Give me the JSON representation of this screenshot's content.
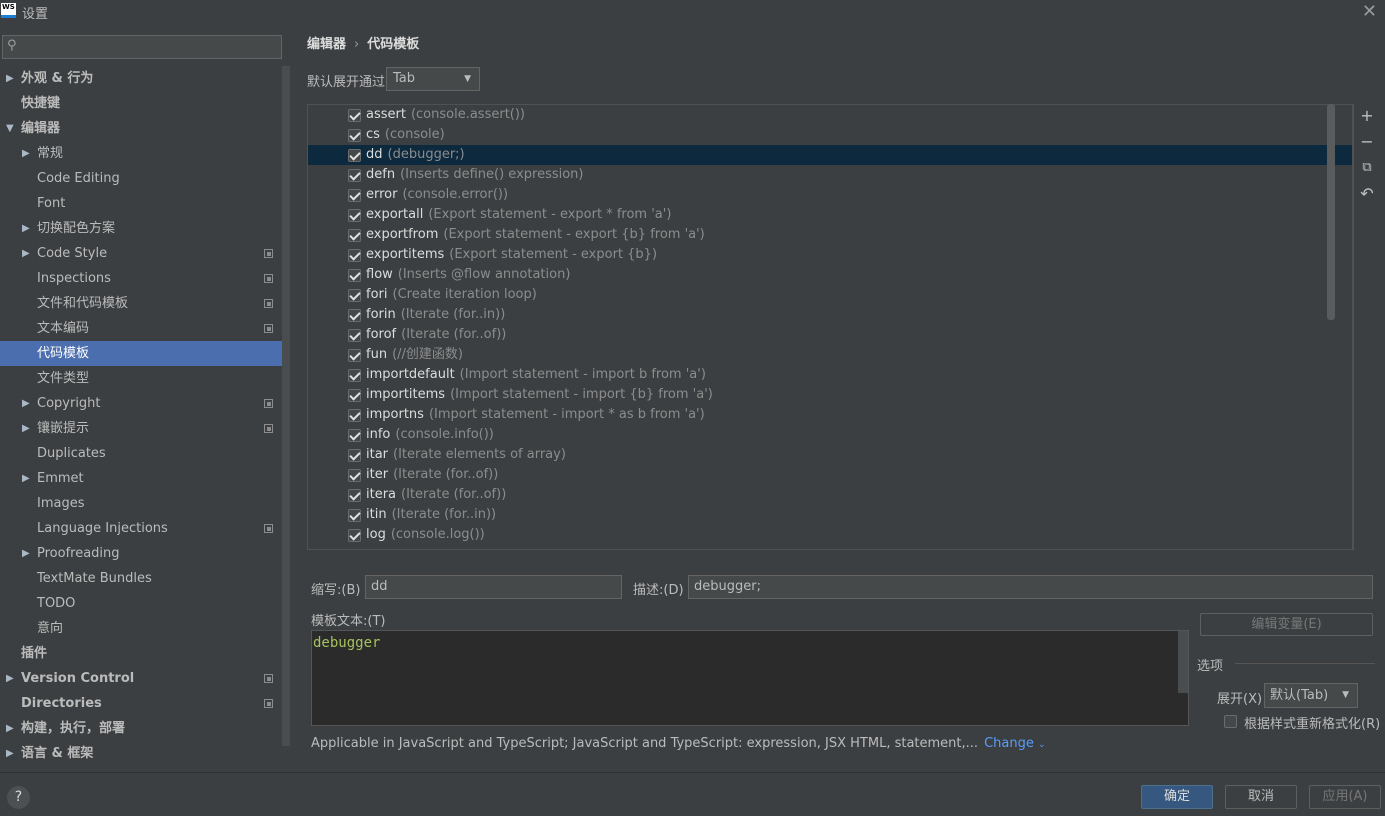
{
  "window": {
    "title": "设置",
    "logo": "WS"
  },
  "search": {
    "value": ""
  },
  "tree": [
    {
      "label": "外观 & 行为",
      "level": 0,
      "arrow": "right",
      "bold": true,
      "copy": false
    },
    {
      "label": "快捷键",
      "level": 0,
      "arrow": "",
      "bold": true,
      "copy": false
    },
    {
      "label": "编辑器",
      "level": 0,
      "arrow": "down",
      "bold": true,
      "copy": false
    },
    {
      "label": "常规",
      "level": 1,
      "arrow": "right",
      "bold": false,
      "copy": false
    },
    {
      "label": "Code Editing",
      "level": 1,
      "arrow": "",
      "bold": false,
      "copy": false
    },
    {
      "label": "Font",
      "level": 1,
      "arrow": "",
      "bold": false,
      "copy": false
    },
    {
      "label": "切换配色方案",
      "level": 1,
      "arrow": "right",
      "bold": false,
      "copy": false
    },
    {
      "label": "Code Style",
      "level": 1,
      "arrow": "right",
      "bold": false,
      "copy": true
    },
    {
      "label": "Inspections",
      "level": 1,
      "arrow": "",
      "bold": false,
      "copy": true
    },
    {
      "label": "文件和代码模板",
      "level": 1,
      "arrow": "",
      "bold": false,
      "copy": true
    },
    {
      "label": "文本编码",
      "level": 1,
      "arrow": "",
      "bold": false,
      "copy": true
    },
    {
      "label": "代码模板",
      "level": 1,
      "arrow": "",
      "bold": false,
      "copy": false,
      "selected": true
    },
    {
      "label": "文件类型",
      "level": 1,
      "arrow": "",
      "bold": false,
      "copy": false
    },
    {
      "label": "Copyright",
      "level": 1,
      "arrow": "right",
      "bold": false,
      "copy": true
    },
    {
      "label": "镶嵌提示",
      "level": 1,
      "arrow": "right",
      "bold": false,
      "copy": true
    },
    {
      "label": "Duplicates",
      "level": 1,
      "arrow": "",
      "bold": false,
      "copy": false
    },
    {
      "label": "Emmet",
      "level": 1,
      "arrow": "right",
      "bold": false,
      "copy": false
    },
    {
      "label": "Images",
      "level": 1,
      "arrow": "",
      "bold": false,
      "copy": false
    },
    {
      "label": "Language Injections",
      "level": 1,
      "arrow": "",
      "bold": false,
      "copy": true
    },
    {
      "label": "Proofreading",
      "level": 1,
      "arrow": "right",
      "bold": false,
      "copy": false
    },
    {
      "label": "TextMate Bundles",
      "level": 1,
      "arrow": "",
      "bold": false,
      "copy": false
    },
    {
      "label": "TODO",
      "level": 1,
      "arrow": "",
      "bold": false,
      "copy": false
    },
    {
      "label": "意向",
      "level": 1,
      "arrow": "",
      "bold": false,
      "copy": false
    },
    {
      "label": "插件",
      "level": 0,
      "arrow": "",
      "bold": true,
      "copy": false
    },
    {
      "label": "Version Control",
      "level": 0,
      "arrow": "right",
      "bold": true,
      "copy": true
    },
    {
      "label": "Directories",
      "level": 0,
      "arrow": "",
      "bold": true,
      "copy": true
    },
    {
      "label": "构建，执行，部署",
      "level": 0,
      "arrow": "right",
      "bold": true,
      "copy": false
    },
    {
      "label": "语言 & 框架",
      "level": 0,
      "arrow": "right",
      "bold": true,
      "copy": false
    }
  ],
  "breadcrumb": {
    "parent": "编辑器",
    "separator": "›",
    "current": "代码模板"
  },
  "expand": {
    "label": "默认展开通过",
    "value": "Tab"
  },
  "templates": [
    {
      "abbr": "assert",
      "desc": "(console.assert())",
      "checked": true
    },
    {
      "abbr": "cs",
      "desc": "(console)",
      "checked": true
    },
    {
      "abbr": "dd",
      "desc": "(debugger;)",
      "checked": true,
      "selected": true
    },
    {
      "abbr": "defn",
      "desc": "(Inserts define() expression)",
      "checked": true
    },
    {
      "abbr": "error",
      "desc": "(console.error())",
      "checked": true
    },
    {
      "abbr": "exportall",
      "desc": "(Export statement - export * from 'a')",
      "checked": true
    },
    {
      "abbr": "exportfrom",
      "desc": "(Export statement - export {b} from 'a')",
      "checked": true
    },
    {
      "abbr": "exportitems",
      "desc": "(Export statement - export {b})",
      "checked": true
    },
    {
      "abbr": "flow",
      "desc": "(Inserts @flow annotation)",
      "checked": true
    },
    {
      "abbr": "fori",
      "desc": "(Create iteration loop)",
      "checked": true
    },
    {
      "abbr": "forin",
      "desc": "(Iterate (for..in))",
      "checked": true
    },
    {
      "abbr": "forof",
      "desc": "(Iterate (for..of))",
      "checked": true
    },
    {
      "abbr": "fun",
      "desc": "(//创建函数)",
      "checked": true
    },
    {
      "abbr": "importdefault",
      "desc": "(Import statement - import b from 'a')",
      "checked": true
    },
    {
      "abbr": "importitems",
      "desc": "(Import statement - import {b} from 'a')",
      "checked": true
    },
    {
      "abbr": "importns",
      "desc": "(Import statement - import * as b from 'a')",
      "checked": true
    },
    {
      "abbr": "info",
      "desc": "(console.info())",
      "checked": true
    },
    {
      "abbr": "itar",
      "desc": "(Iterate elements of array)",
      "checked": true
    },
    {
      "abbr": "iter",
      "desc": "(Iterate (for..of))",
      "checked": true
    },
    {
      "abbr": "itera",
      "desc": "(Iterate (for..of))",
      "checked": true
    },
    {
      "abbr": "itin",
      "desc": "(Iterate (for..in))",
      "checked": true
    },
    {
      "abbr": "log",
      "desc": "(console.log())",
      "checked": true
    }
  ],
  "tools": {
    "add": "+",
    "remove": "−",
    "copy": "⧉",
    "revert": "↶"
  },
  "fields": {
    "abbr_label": "缩写:(B)",
    "abbr_value": "dd",
    "desc_label": "描述:(D)",
    "desc_value": "debugger;",
    "template_label": "模板文本:(T)",
    "template_text": "debugger",
    "edit_vars": "编辑变量(E)",
    "options_title": "选项",
    "expand_label": "展开(X)",
    "expand_value": "默认(Tab)",
    "reformat_label": "根据样式重新格式化(R)",
    "applicable": "Applicable in JavaScript and TypeScript; JavaScript and TypeScript: expression, JSX HTML, statement,...",
    "change": "Change"
  },
  "buttons": {
    "ok": "确定",
    "cancel": "取消",
    "apply": "应用(A)",
    "help": "?"
  }
}
